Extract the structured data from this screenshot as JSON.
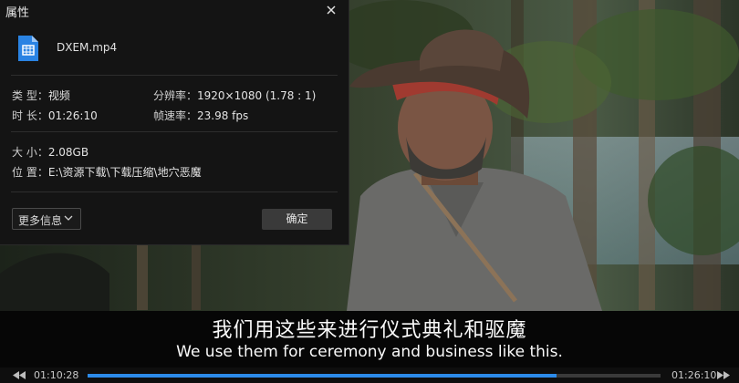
{
  "dialog": {
    "title": "属性",
    "file_name": "DXEM.mp4",
    "type_label": "类  型：",
    "type_value": "视频",
    "resolution_label": "分辨率：",
    "resolution_value": "1920×1080 (1.78 : 1)",
    "duration_label": "时  长：",
    "duration_value": "01:26:10",
    "framerate_label": "帧速率：",
    "framerate_value": "23.98 fps",
    "size_label": "大  小：",
    "size_value": "2.08GB",
    "location_label": "位  置：",
    "location_value": "E:\\资源下载\\下载压缩\\地穴恶魔",
    "more_info_label": "更多信息",
    "ok_label": "确定"
  },
  "subtitle": {
    "chinese": "我们用这些来进行仪式典礼和驱魔",
    "english": "We use them for ceremony and business like this."
  },
  "player": {
    "current_time": "01:10:28",
    "total_time": "01:26:10",
    "progress": 0.818,
    "accent_color": "#2c8bea"
  }
}
